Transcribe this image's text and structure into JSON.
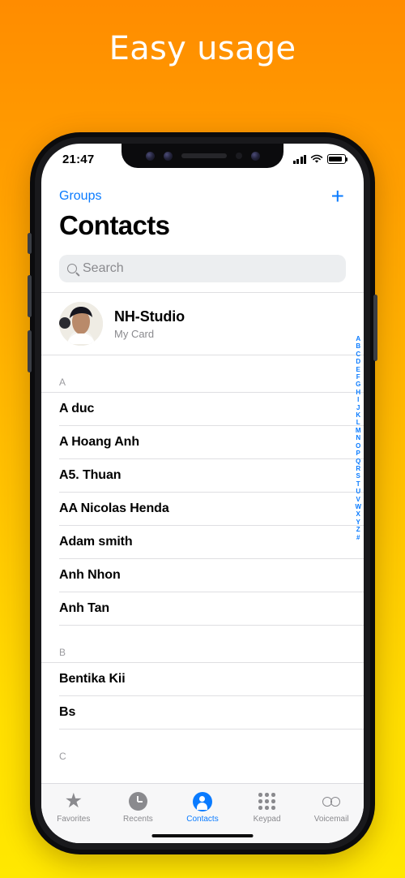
{
  "headline": "Easy usage",
  "colors": {
    "accent": "#0a7bff",
    "bg_top": "#FF8C00",
    "bg_bottom": "#FFE800",
    "muted": "#8a8a8e"
  },
  "status_bar": {
    "time": "21:47",
    "signal_icon": "signal-bars-icon",
    "wifi_icon": "wifi-icon",
    "battery_icon": "battery-icon"
  },
  "nav": {
    "groups_label": "Groups",
    "add_label": "+"
  },
  "page_title": "Contacts",
  "search": {
    "placeholder": "Search",
    "value": "",
    "icon": "search-icon"
  },
  "my_card": {
    "name": "NH-Studio",
    "subtitle": "My Card",
    "avatar": "user-avatar-photo"
  },
  "sections": [
    {
      "letter": "A",
      "contacts": [
        "A duc",
        "A Hoang Anh",
        "A5. Thuan",
        "AA Nicolas Henda",
        "Adam smith",
        "Anh Nhon",
        "Anh Tan"
      ]
    },
    {
      "letter": "B",
      "contacts": [
        "Bentika Kii",
        "Bs"
      ]
    },
    {
      "letter": "C",
      "contacts": []
    }
  ],
  "alpha_index": [
    "A",
    "B",
    "C",
    "D",
    "E",
    "F",
    "G",
    "H",
    "I",
    "J",
    "K",
    "L",
    "M",
    "N",
    "O",
    "P",
    "Q",
    "R",
    "S",
    "T",
    "U",
    "V",
    "W",
    "X",
    "Y",
    "Z",
    "#"
  ],
  "tabs": [
    {
      "label": "Favorites",
      "icon": "star-icon",
      "active": false
    },
    {
      "label": "Recents",
      "icon": "clock-icon",
      "active": false
    },
    {
      "label": "Contacts",
      "icon": "person-circle-icon",
      "active": true
    },
    {
      "label": "Keypad",
      "icon": "keypad-dots-icon",
      "active": false
    },
    {
      "label": "Voicemail",
      "icon": "voicemail-icon",
      "active": false
    }
  ]
}
